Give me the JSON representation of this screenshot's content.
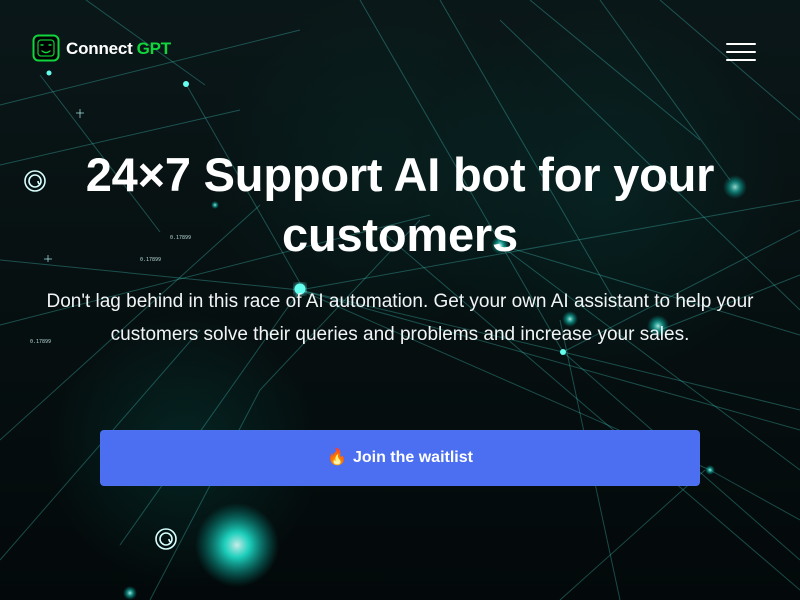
{
  "brand": {
    "name_primary": "Connect",
    "name_accent": "GPT",
    "colors": {
      "background": "#071417",
      "text": "#ffffff",
      "accent_green": "#10d53c",
      "button": "#4b6ff0",
      "network_glow": "#29f3de"
    },
    "icons": {
      "logo": "robot-face-icon",
      "menu": "hamburger-menu-icon",
      "button": "fire-icon"
    }
  },
  "hero": {
    "title": "24×7 Support AI bot for your customers",
    "subtitle": "Don't lag behind in this race of AI automation. Get your own AI assistant to help your customers solve their queries and problems and increase your sales.",
    "cta_label": "Join the waitlist",
    "cta_icon": "🔥"
  },
  "background": {
    "tiny_labels": [
      "0.17899",
      "0.17899",
      "0.17899"
    ]
  }
}
